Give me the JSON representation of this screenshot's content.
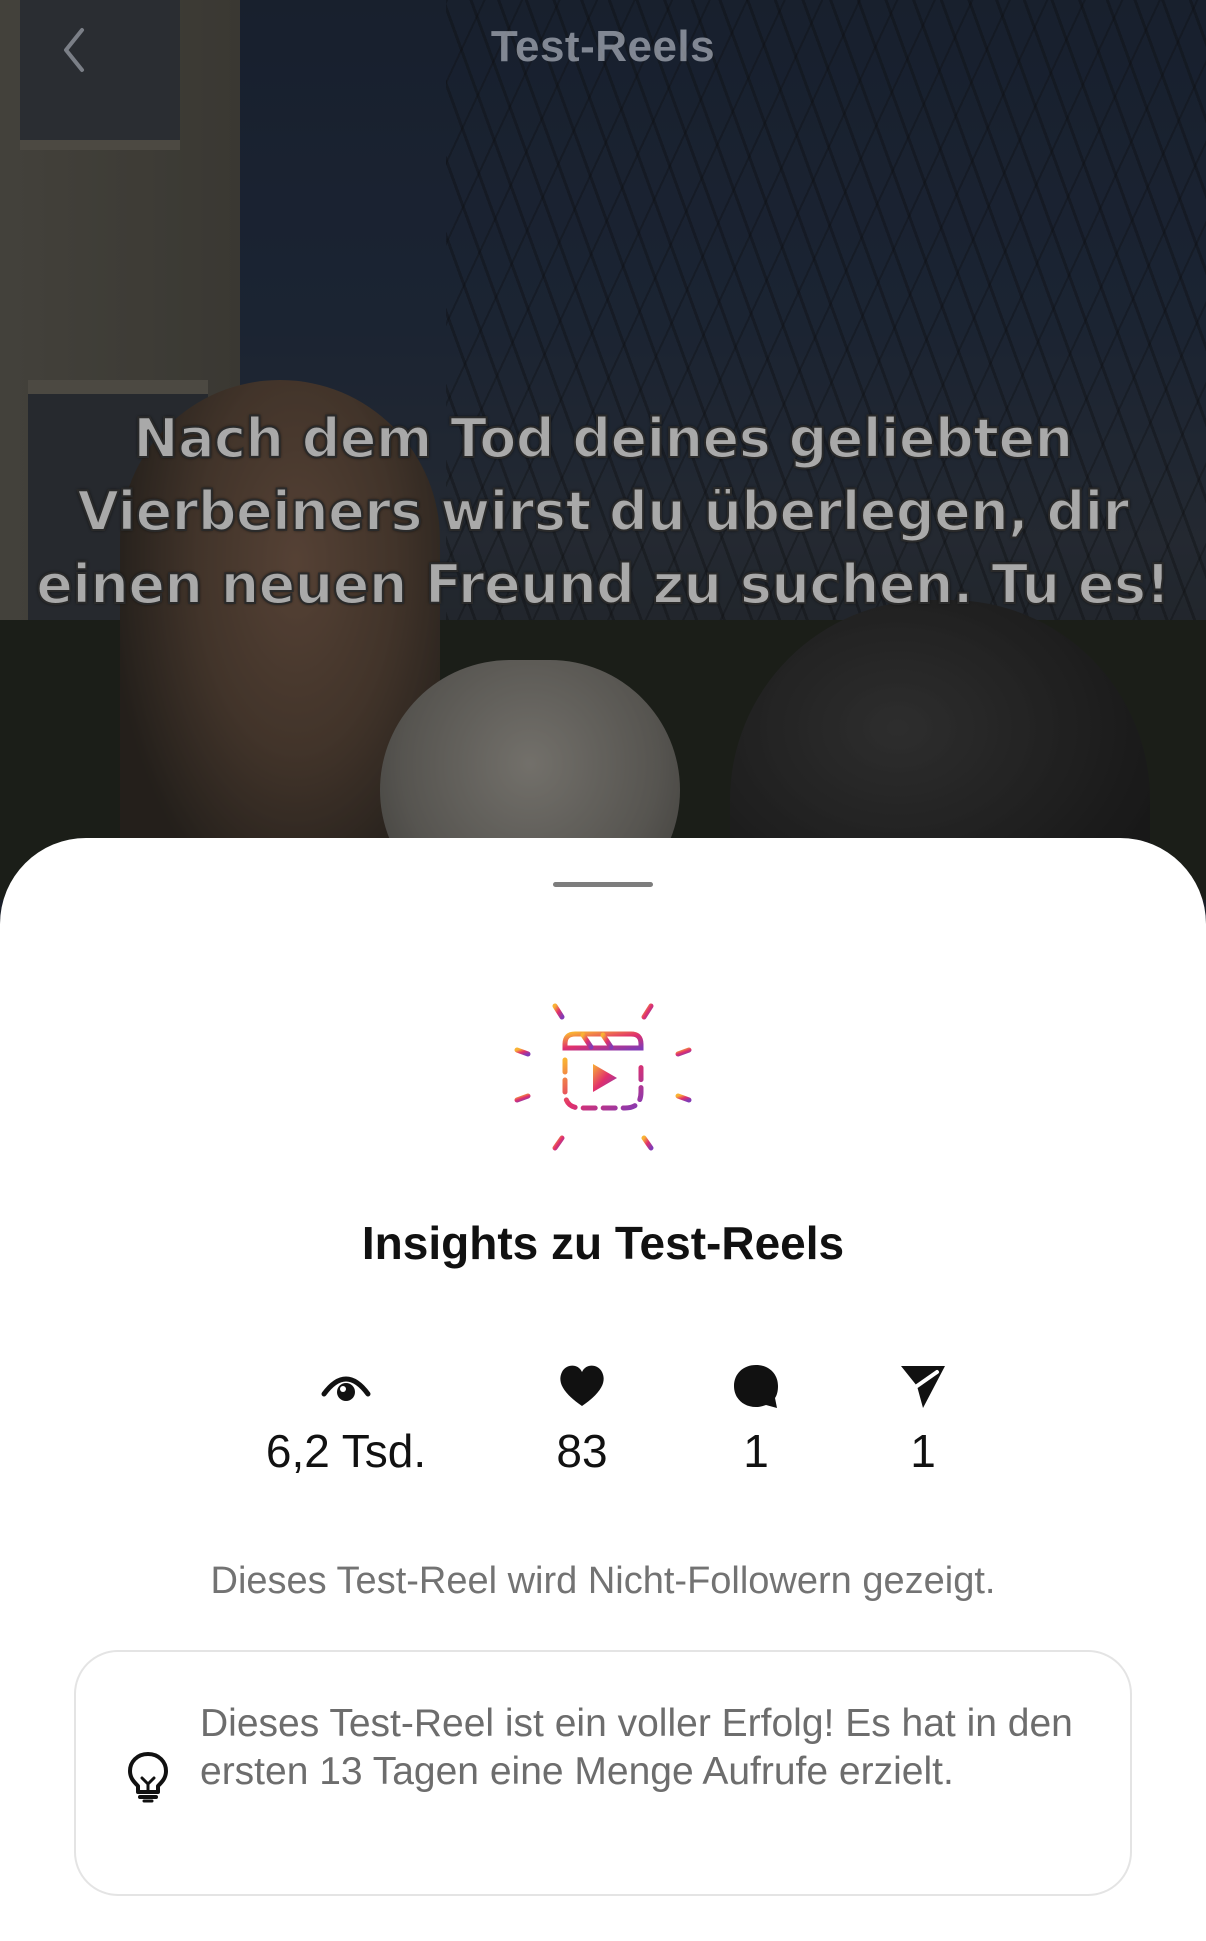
{
  "header": {
    "title": "Test-Reels"
  },
  "reel": {
    "caption": "Nach dem Tod deines geliebten Vierbeiners wirst du überlegen, dir einen neuen Freund zu suchen. Tu es!"
  },
  "sheet": {
    "title": "Insights zu Test-Reels",
    "stats": {
      "views": "6,2 Tsd.",
      "likes": "83",
      "comments": "1",
      "shares": "1"
    },
    "reach_note": "Dieses Test-Reel wird Nicht-Followern gezeigt.",
    "tip": "Dieses Test-Reel ist ein voller Erfolg! Es hat in den ersten 13 Tagen eine Menge Aufrufe erzielt."
  },
  "icons": {
    "back": "chevron-left-icon",
    "reels_burst": "reels-burst-icon",
    "views": "eye-icon",
    "likes": "heart-icon",
    "comments": "comment-bubble-icon",
    "shares": "paper-plane-icon",
    "tip": "lightbulb-icon"
  },
  "colors": {
    "gradient_start": "#F9B233",
    "gradient_mid": "#E1306C",
    "gradient_end": "#833AB4",
    "text_primary": "#111111",
    "text_secondary": "#737373"
  }
}
